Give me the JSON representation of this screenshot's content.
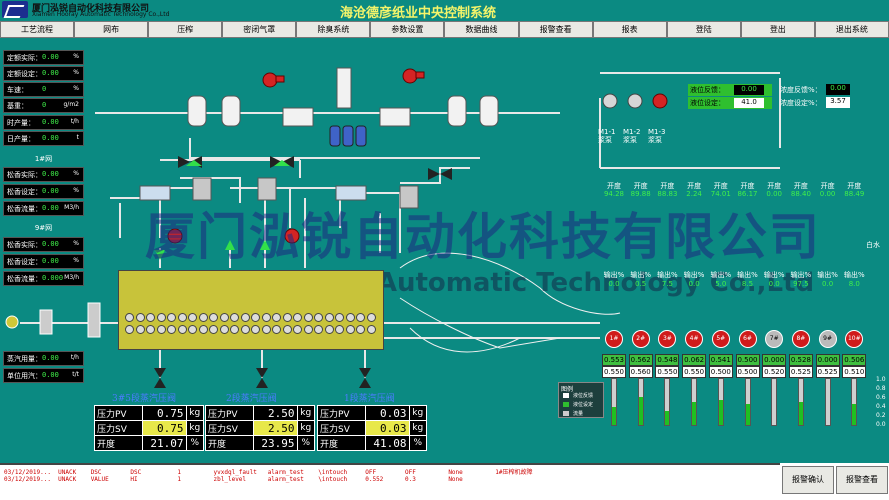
{
  "header": {
    "company_cn": "厦门泓锐自动化科技有限公司",
    "company_en": "Xiamen Hooray Automatic Technology Co.,Ltd",
    "title": "海沧德彦纸业中央控制系统"
  },
  "nav": [
    "工艺流程",
    "网布",
    "压榨",
    "密闭气罩",
    "除臭系统",
    "参数设置",
    "数据曲线",
    "报警查看",
    "报表",
    "登陆",
    "登出",
    "退出系统"
  ],
  "left_panel": {
    "rows_top": [
      {
        "label": "定额实际：",
        "value": "0.00",
        "unit": "%"
      },
      {
        "label": "定额设定：",
        "value": "0.00",
        "unit": "%"
      },
      {
        "label": "车速：",
        "value": "0",
        "unit": "%"
      },
      {
        "label": "基重：",
        "value": "0",
        "unit": "g/m2"
      },
      {
        "label": "时产量：",
        "value": "0.00",
        "unit": "t/h"
      },
      {
        "label": "日产量：",
        "value": "0.00",
        "unit": "t"
      }
    ],
    "group1_title": "1#网",
    "group1": [
      {
        "label": "松香实际：",
        "value": "0.00",
        "unit": "%"
      },
      {
        "label": "松香设定：",
        "value": "0.00",
        "unit": "%"
      },
      {
        "label": "松香流量：",
        "value": "0.00",
        "unit": "M3/h"
      }
    ],
    "group2_title": "9#网",
    "group2": [
      {
        "label": "松香实际：",
        "value": "0.00",
        "unit": "%"
      },
      {
        "label": "松香设定：",
        "value": "0.00",
        "unit": "%"
      },
      {
        "label": "松香流量：",
        "value": "0.000",
        "unit": "M3/h"
      }
    ],
    "rows_bottom": [
      {
        "label": "蒸汽用量：",
        "value": "0.00",
        "unit": "t/h"
      },
      {
        "label": "单位用汽：",
        "value": "0.00",
        "unit": "t/t"
      }
    ]
  },
  "watermark": {
    "cn": "厦门泓锐自动化科技有限公司",
    "en": "Xiamen Hooray Automatic Technology Co.,Ltd"
  },
  "pressure": [
    {
      "title": "3#5段蒸汽压阀",
      "pv": "0.75",
      "sv": "0.75",
      "open": "21.07",
      "pv_label": "压力PV",
      "sv_label": "压力SV",
      "open_label": "开度",
      "unit_p": "kg",
      "unit_o": "%"
    },
    {
      "title": "2段蒸汽压阀",
      "pv": "2.50",
      "sv": "2.50",
      "open": "23.95",
      "pv_label": "压力PV",
      "sv_label": "压力SV",
      "open_label": "开度",
      "unit_p": "kg",
      "unit_o": "%"
    },
    {
      "title": "1段蒸汽压阀",
      "pv": "0.03",
      "sv": "0.03",
      "open": "41.08",
      "pv_label": "压力PV",
      "sv_label": "压力SV",
      "open_label": "开度",
      "unit_p": "kg",
      "unit_o": "%"
    }
  ],
  "slurry": {
    "level_feedback_label": "液位反馈：",
    "level_feedback": "0.00",
    "level_set_label": "液位设定：",
    "level_set": "41.0",
    "conc_feedback_label": "浓度反馈%：",
    "conc_feedback": "0.00",
    "conc_set_label": "浓度设定%：",
    "conc_set": "3.57",
    "pumps": [
      "M1-1\n浆泵",
      "M1-2\n浆泵",
      "M1-3\n浆泵"
    ]
  },
  "dosing": {
    "top_label": "开度",
    "top_values": [
      "94.28",
      "89.88",
      "88.83",
      "2.24",
      "74.01",
      "86.17",
      "0.00",
      "88.40",
      "0.00",
      "88.49"
    ],
    "out_label": "输出%",
    "out_values": [
      "0.0",
      "0.5",
      "7.5",
      "0.0",
      "5.0",
      "8.5",
      "0.0",
      "97.5",
      "0.0",
      "8.0"
    ],
    "side_label": "白水",
    "units": [
      {
        "id": "1#",
        "color": "red",
        "pv": "0.553",
        "sv": "0.550",
        "bar": 0.4
      },
      {
        "id": "2#",
        "color": "red",
        "pv": "0.562",
        "sv": "0.560",
        "bar": 0.6
      },
      {
        "id": "3#",
        "color": "red",
        "pv": "0.548",
        "sv": "0.550",
        "bar": 0.3
      },
      {
        "id": "4#",
        "color": "red",
        "pv": "0.062",
        "sv": "0.550",
        "bar": 0.5
      },
      {
        "id": "5#",
        "color": "red",
        "pv": "0.541",
        "sv": "0.500",
        "bar": 0.55
      },
      {
        "id": "6#",
        "color": "red",
        "pv": "0.500",
        "sv": "0.500",
        "bar": 0.45
      },
      {
        "id": "7#",
        "color": "grey",
        "pv": "0.000",
        "sv": "0.520",
        "bar": 0.0
      },
      {
        "id": "8#",
        "color": "red",
        "pv": "0.528",
        "sv": "0.525",
        "bar": 0.5
      },
      {
        "id": "9#",
        "color": "grey",
        "pv": "0.000",
        "sv": "0.525",
        "bar": 0.0
      },
      {
        "id": "10#",
        "color": "red",
        "pv": "0.506",
        "sv": "0.510",
        "bar": 0.45
      }
    ],
    "scale": [
      "1.0",
      "0.8",
      "0.6",
      "0.4",
      "0.2",
      "0.0"
    ]
  },
  "legend": {
    "title": "图例",
    "items": [
      "液位反馈",
      "液位设定",
      "流量"
    ]
  },
  "alarms": [
    "03/12/2019...  UNACK    DSC        DSC          1         yvxdql_fault   alarm_test    \\intouch     OFF        OFF         None         1#压榨机故障",
    "03/12/2019...  UNACK    VALUE      HI           1         zbl_level      alarm_test    \\intouch     0.552      0.3         None"
  ],
  "alarm_buttons": {
    "confirm": "报警确认",
    "view": "报警查看"
  }
}
